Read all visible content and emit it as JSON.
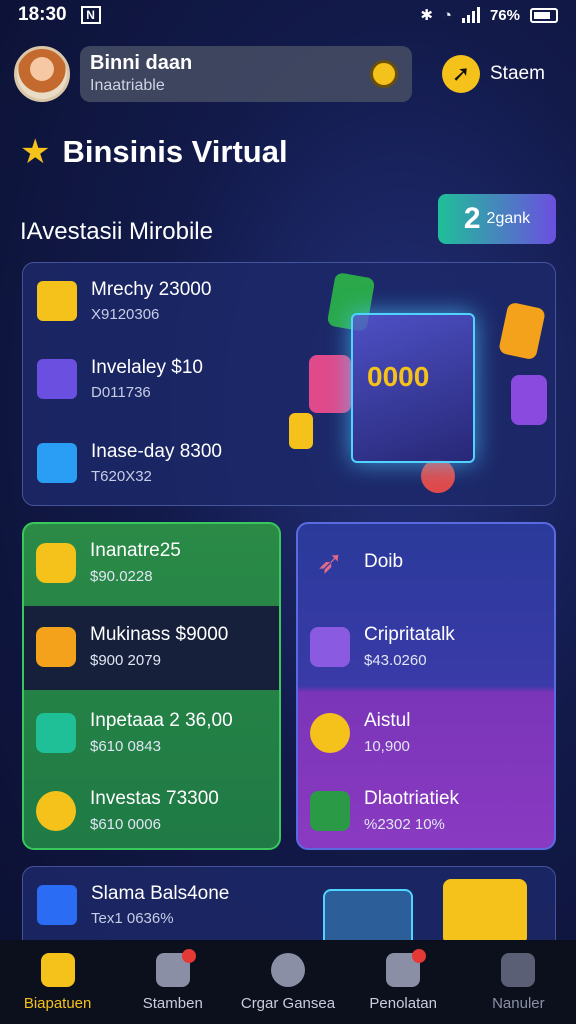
{
  "status_bar": {
    "time": "18:30",
    "battery": "76%"
  },
  "header": {
    "profile_name": "Binni daan",
    "profile_sub": "Inaatriable",
    "stream_label": "Staem"
  },
  "page": {
    "title": "Binsinis Virtual",
    "section_title": "IAvestasii Mirobile"
  },
  "pill": {
    "number": "2",
    "label": "2gank"
  },
  "investments": [
    {
      "title": "Mrechy 23000",
      "sub": "X9120306",
      "color": "#f4c21b"
    },
    {
      "title": "Invelaley $10",
      "sub": "D011736",
      "color": "#6b4fe0"
    },
    {
      "title": "Inase-day 8300",
      "sub": "T620X32",
      "color": "#2a9df4"
    }
  ],
  "cube_label": "0000",
  "green_items": [
    {
      "title": "Inanatre25",
      "sub": "$90.0228",
      "color": "#f4c21b"
    },
    {
      "title": "Mukinass $9000",
      "sub": "$900 2079",
      "color": "#f4a21b"
    },
    {
      "title": "Inpetaaa 2 36,00",
      "sub": "$610 0843",
      "color": "#1fbf98"
    },
    {
      "title": "Investas 73300",
      "sub": "$610 0006",
      "color": "#f4c21b"
    }
  ],
  "purple_items": [
    {
      "title": "Doib",
      "sub": "",
      "color": "#e06a8a"
    },
    {
      "title": "Cripritatalk",
      "sub": "$43.0260",
      "color": "#8a5be0"
    },
    {
      "title": "Aistul",
      "sub": "10,900",
      "color": "#f4c21b"
    },
    {
      "title": "Dlaotriatiek",
      "sub": "%2302 10%",
      "color": "#2a9a46"
    }
  ],
  "bottom_item": {
    "title": "Slama Bals4one",
    "sub": "Tex1 0636%",
    "color": "#2a6df4"
  },
  "tabs": [
    {
      "label": "Biapatuen",
      "state": "active"
    },
    {
      "label": "Stamben",
      "state": "normal"
    },
    {
      "label": "Crgar Gansea",
      "state": "normal"
    },
    {
      "label": "Penolatan",
      "state": "normal"
    },
    {
      "label": "Nanuler",
      "state": "dim"
    }
  ]
}
